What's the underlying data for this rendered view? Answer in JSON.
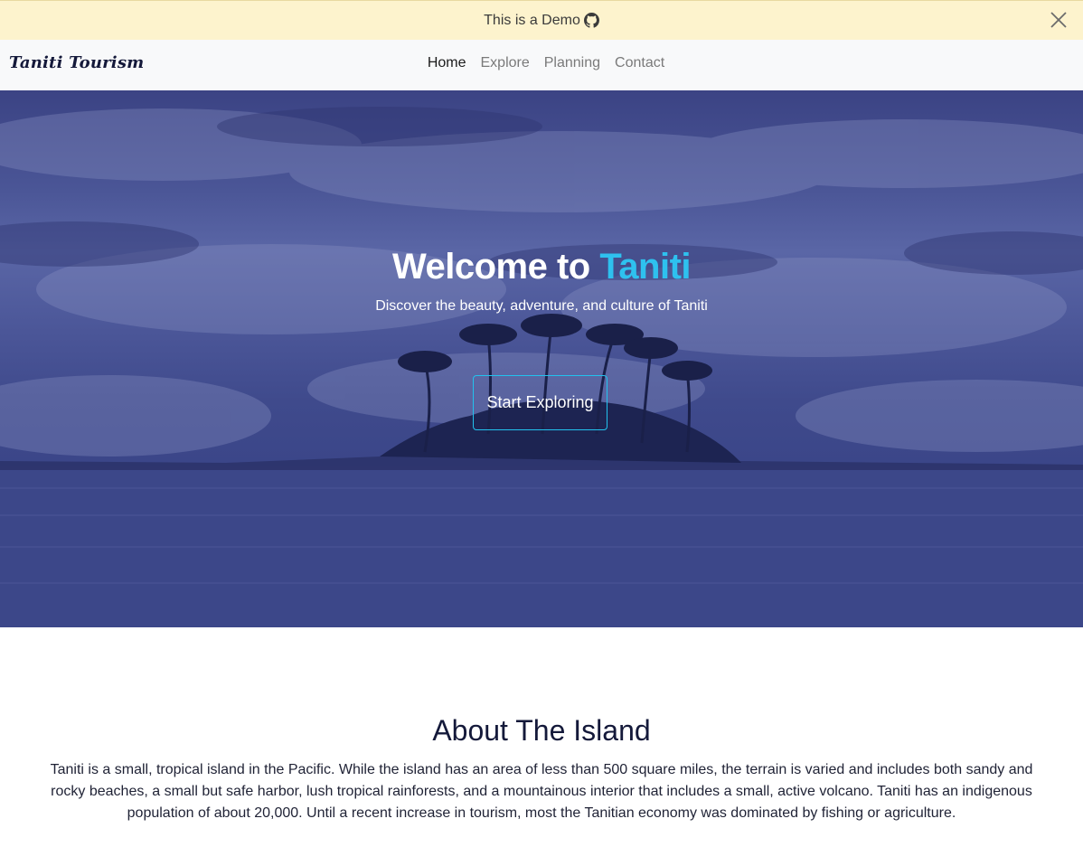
{
  "banner": {
    "text": "This is a Demo",
    "github_icon": "github-icon",
    "close_icon": "close-icon"
  },
  "navbar": {
    "brand": "Taniti Tourism",
    "links": [
      {
        "label": "Home",
        "active": true
      },
      {
        "label": "Explore",
        "active": false
      },
      {
        "label": "Planning",
        "active": false
      },
      {
        "label": "Contact",
        "active": false
      }
    ]
  },
  "hero": {
    "title_prefix": "Welcome to ",
    "title_accent": "Taniti",
    "subtitle": "Discover the beauty, adventure, and culture of Taniti",
    "cta_label": "Start Exploring",
    "accent_color": "#2ec1ef"
  },
  "about": {
    "title": "About The Island",
    "text": "Taniti is a small, tropical island in the Pacific. While the island has an area of less than 500 square miles, the terrain is varied and includes both sandy and rocky beaches, a small but safe harbor, lush tropical rainforests, and a mountainous interior that includes a small, active volcano. Taniti has an indigenous population of about 20,000. Until a recent increase in tourism, most the Tanitian economy was dominated by fishing or agriculture."
  }
}
